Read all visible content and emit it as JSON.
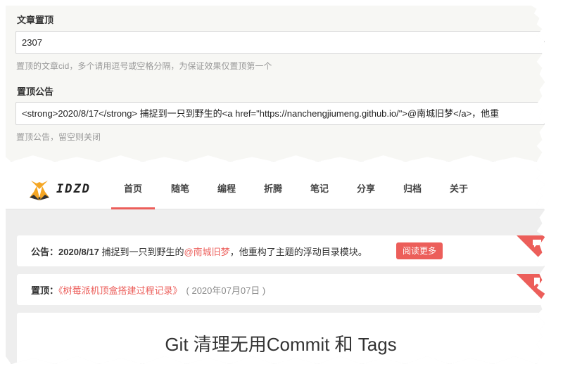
{
  "settings": {
    "sticky_label": "文章置顶",
    "sticky_value": "2307",
    "sticky_help": "置顶的文章cid，多个请用逗号或空格分隔，为保证效果仅置顶第一个",
    "notice_label": "置顶公告",
    "notice_value": "<strong>2020/8/17</strong> 捕捉到一只到野生的<a href=\"https://nanchengjiumeng.github.io/\">@南城旧梦</a>，他重",
    "notice_help": "置顶公告，留空则关闭"
  },
  "site": {
    "logo_text": "IDZD",
    "nav": [
      "首页",
      "随笔",
      "编程",
      "折腾",
      "笔记",
      "分享",
      "归档",
      "关于"
    ],
    "active_index": 0
  },
  "notice": {
    "prefix": "公告：",
    "date": "2020/8/17",
    "text_before": " 捕捉到一只到野生的",
    "link": "@南城旧梦",
    "text_after": "，他重构了主题的浮动目录模块。",
    "read_more": "阅读更多"
  },
  "pinned": {
    "prefix": "置顶：",
    "title": "《树莓派机顶盒搭建过程记录》",
    "date": "( 2020年07月07日 )"
  },
  "post": {
    "title": "Git 清理无用Commit 和 Tags"
  },
  "colors": {
    "accent": "#ec5e5a",
    "panel_bg": "#f7f7f4",
    "page_bg": "#eeeeee"
  },
  "icons": {
    "logo": "fox-logo-icon",
    "notice_corner": "comment-icon",
    "pinned_corner": "bookmark-icon"
  }
}
